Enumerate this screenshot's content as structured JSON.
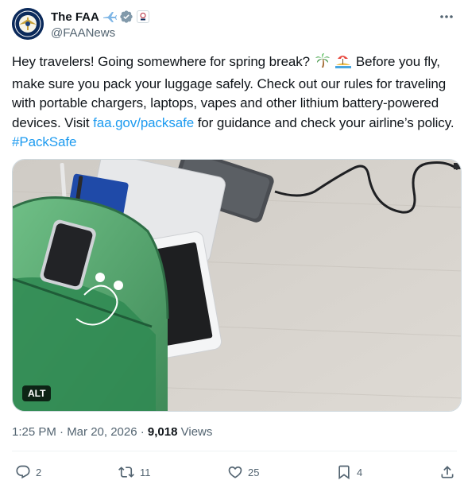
{
  "author": {
    "display_name": "The FAA",
    "handle": "@FAANews",
    "verified": true
  },
  "tweet": {
    "text_1": "Hey travelers! Going somewhere for spring break?",
    "text_2": "Before you fly, make sure you pack your luggage safely. Check out our rules for traveling with portable chargers, laptops, vapes and other lithium battery-powered devices. Visit",
    "link": "faa.gov/packsafe",
    "text_3": "for guidance and check your airline’s policy.",
    "hashtag": "#PackSafe"
  },
  "media": {
    "alt_label": "ALT"
  },
  "meta": {
    "timestamp": "1:25 PM · Mar 20, 2026 ·",
    "views_count": "9,018",
    "views_label": "Views"
  },
  "actions": {
    "replies": "2",
    "reposts": "11",
    "likes": "25",
    "bookmarks": "4"
  },
  "icons": [
    "airplane-icon",
    "verified-badge-icon",
    "affiliate-badge-icon",
    "more-icon",
    "palm-tree-icon",
    "island-icon",
    "reply-icon",
    "repost-icon",
    "like-icon",
    "bookmark-icon",
    "share-icon"
  ],
  "colors": {
    "link": "#1d9bf0",
    "verified": "#829aab",
    "text": "#0f1419",
    "secondary": "#536471"
  }
}
